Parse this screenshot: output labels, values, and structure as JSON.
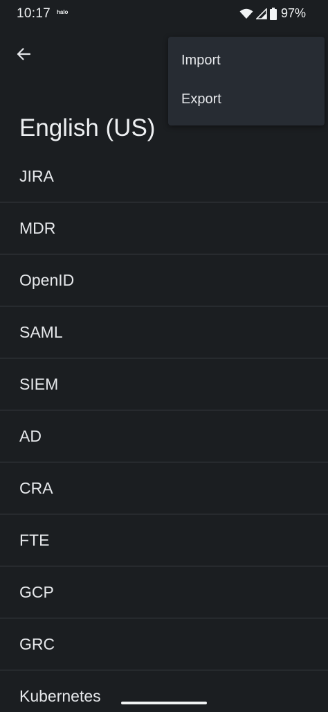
{
  "status_bar": {
    "time": "10:17",
    "notification_label": "halo",
    "battery_percent": "97%"
  },
  "toolbar": {
    "back_icon": "arrow-back-icon"
  },
  "page": {
    "title": "English (US)"
  },
  "words": [
    {
      "label": "JIRA"
    },
    {
      "label": "MDR"
    },
    {
      "label": "OpenID"
    },
    {
      "label": "SAML"
    },
    {
      "label": "SIEM"
    },
    {
      "label": "AD"
    },
    {
      "label": "CRA"
    },
    {
      "label": "FTE"
    },
    {
      "label": "GCP"
    },
    {
      "label": "GRC"
    },
    {
      "label": "Kubernetes"
    }
  ],
  "overflow_menu": {
    "items": [
      {
        "label": "Import"
      },
      {
        "label": "Export"
      }
    ]
  },
  "colors": {
    "background": "#1b1e21",
    "menu_background": "#272c33",
    "divider": "#3a3e43",
    "text": "#e6e8eb"
  }
}
